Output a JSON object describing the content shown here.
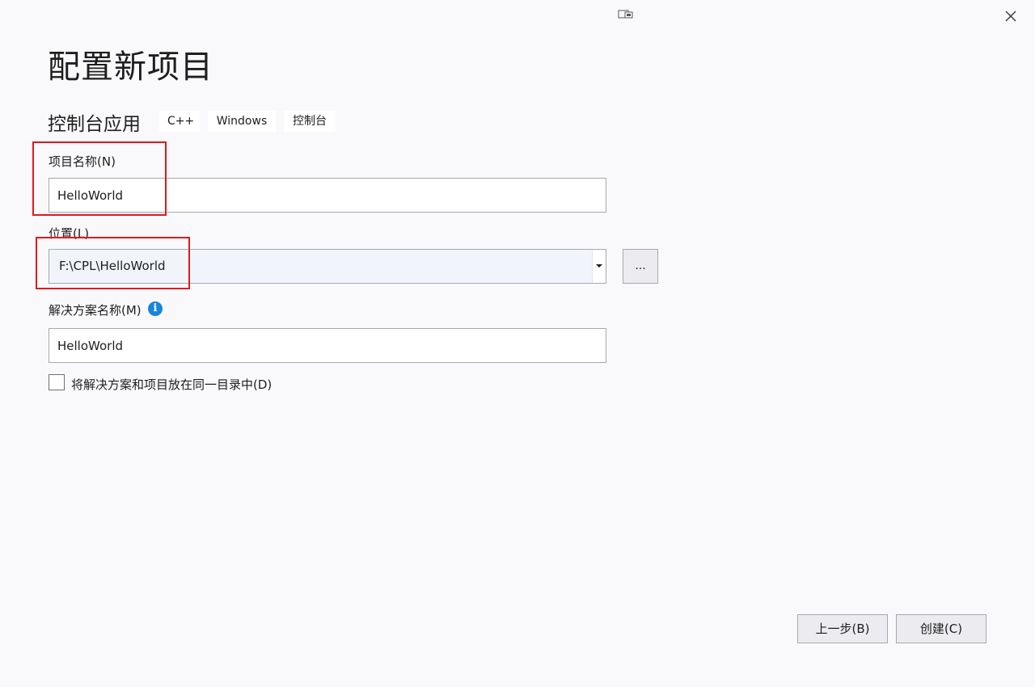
{
  "window": {
    "restore_icon": "restore-window-icon",
    "close_icon": "close-icon"
  },
  "page": {
    "title": "配置新项目"
  },
  "template": {
    "name": "控制台应用",
    "tags": [
      "C++",
      "Windows",
      "控制台"
    ]
  },
  "project_name": {
    "label": "项目名称(N)",
    "value": "HelloWorld"
  },
  "location": {
    "label": "位置(L)",
    "value": "F:\\CPL\\HelloWorld",
    "browse_label": "..."
  },
  "solution_name": {
    "label": "解决方案名称(M)",
    "info_icon": "info-icon",
    "value": "HelloWorld"
  },
  "same_directory": {
    "label": "将解决方案和项目放在同一目录中(D)",
    "checked": false
  },
  "footer": {
    "back_label": "上一步(B)",
    "create_label": "创建(C)"
  },
  "colors": {
    "background": "#f9f9fb",
    "highlight": "#e0191f",
    "info": "#1a86d9"
  }
}
